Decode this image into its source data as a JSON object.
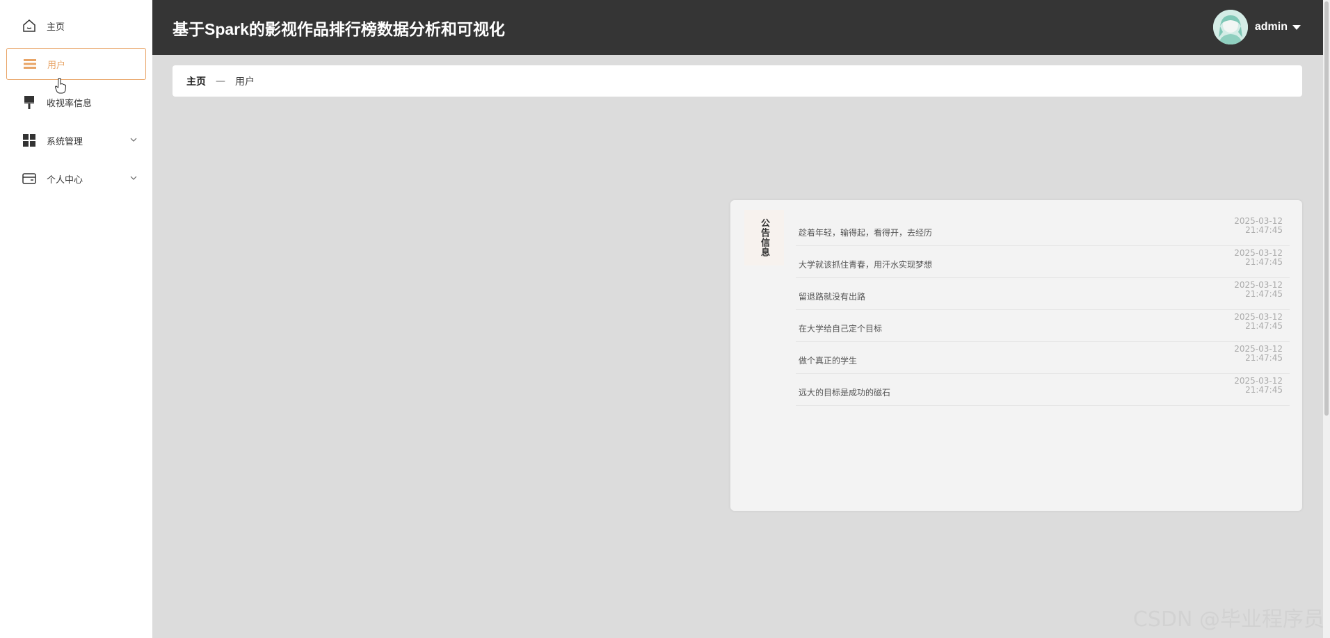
{
  "app": {
    "title": "基于Spark的影视作品排行榜数据分析和可视化"
  },
  "user": {
    "name": "admin"
  },
  "sidebar": {
    "items": [
      {
        "label": "主页",
        "icon": "home-icon"
      },
      {
        "label": "用户",
        "icon": "menu-icon",
        "active": true
      },
      {
        "label": "收视率信息",
        "icon": "brush-icon"
      },
      {
        "label": "系统管理",
        "icon": "grid-icon",
        "expandable": true
      },
      {
        "label": "个人中心",
        "icon": "card-icon",
        "expandable": true
      }
    ]
  },
  "breadcrumb": {
    "home": "主页",
    "separator": "—",
    "current": "用户"
  },
  "notice": {
    "label": "公告信息",
    "items": [
      {
        "text": "趁着年轻，输得起，看得开，去经历",
        "date": "2025-03-12",
        "time": "21:47:45"
      },
      {
        "text": "大学就该抓住青春，用汗水实现梦想",
        "date": "2025-03-12",
        "time": "21:47:45"
      },
      {
        "text": "留退路就没有出路",
        "date": "2025-03-12",
        "time": "21:47:45"
      },
      {
        "text": "在大学给自己定个目标",
        "date": "2025-03-12",
        "time": "21:47:45"
      },
      {
        "text": "做个真正的学生",
        "date": "2025-03-12",
        "time": "21:47:45"
      },
      {
        "text": "远大的目标是成功的磁石",
        "date": "2025-03-12",
        "time": "21:47:45"
      }
    ]
  },
  "watermark": "CSDN @毕业程序员",
  "colors": {
    "accent": "#e8a466",
    "header_bg": "#353535",
    "content_bg": "#dcdcdc"
  }
}
